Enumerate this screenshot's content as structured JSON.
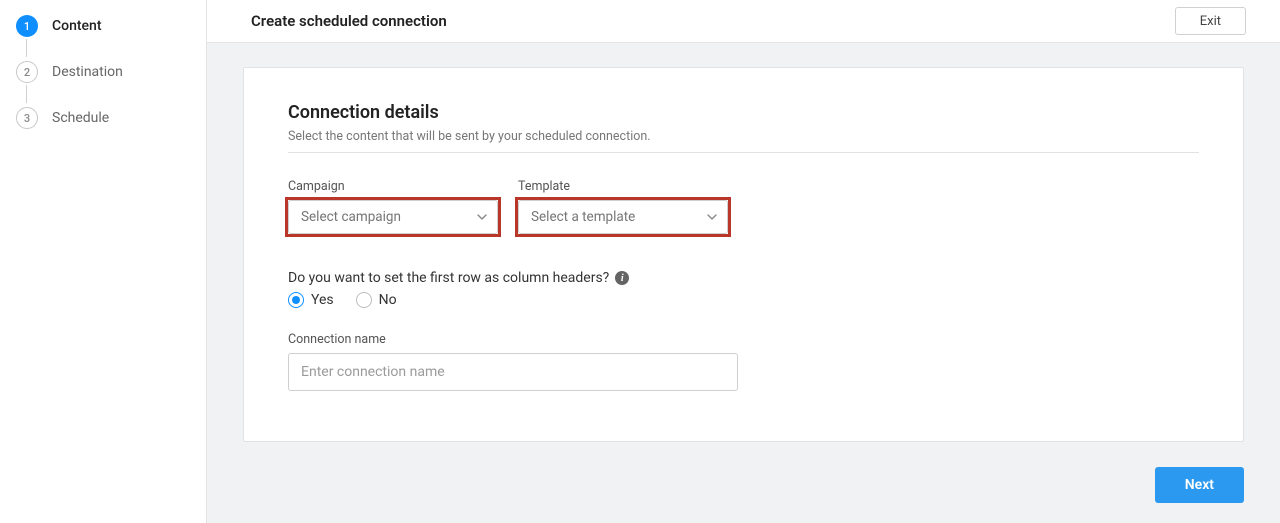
{
  "sidebar": {
    "steps": [
      {
        "num": "1",
        "label": "Content",
        "active": true
      },
      {
        "num": "2",
        "label": "Destination",
        "active": false
      },
      {
        "num": "3",
        "label": "Schedule",
        "active": false
      }
    ]
  },
  "topbar": {
    "title": "Create scheduled connection",
    "exit_label": "Exit"
  },
  "section": {
    "title": "Connection details",
    "subtitle": "Select the content that will be sent by your scheduled connection."
  },
  "fields": {
    "campaign": {
      "label": "Campaign",
      "placeholder": "Select campaign"
    },
    "template": {
      "label": "Template",
      "placeholder": "Select a template"
    },
    "header_question": "Do you want to set the first row as column headers?",
    "radio_yes": "Yes",
    "radio_no": "No",
    "connection_name": {
      "label": "Connection name",
      "placeholder": "Enter connection name"
    }
  },
  "footer": {
    "next_label": "Next"
  }
}
